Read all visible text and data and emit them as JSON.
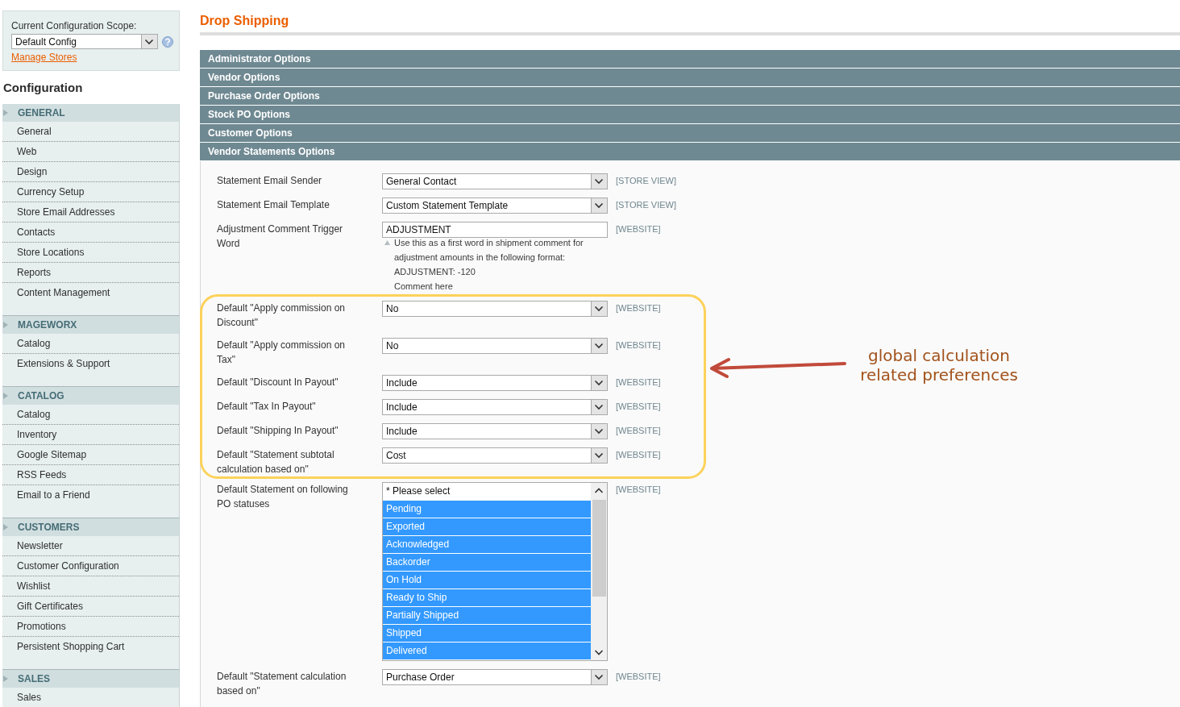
{
  "sidebar": {
    "scope": {
      "label": "Current Configuration Scope:",
      "value": "Default Config",
      "link": "Manage Stores"
    },
    "title": "Configuration",
    "groups": [
      {
        "title": "GENERAL",
        "items": [
          "General",
          "Web",
          "Design",
          "Currency Setup",
          "Store Email Addresses",
          "Contacts",
          "Store Locations",
          "Reports",
          "Content Management"
        ]
      },
      {
        "title": "MAGEWORX",
        "items": [
          "Catalog",
          "Extensions & Support"
        ]
      },
      {
        "title": "CATALOG",
        "items": [
          "Catalog",
          "Inventory",
          "Google Sitemap",
          "RSS Feeds",
          "Email to a Friend"
        ]
      },
      {
        "title": "CUSTOMERS",
        "items": [
          "Newsletter",
          "Customer Configuration",
          "Wishlist",
          "Gift Certificates",
          "Promotions",
          "Persistent Shopping Cart"
        ]
      },
      {
        "title": "SALES",
        "items": [
          "Sales"
        ]
      }
    ]
  },
  "page": {
    "title": "Drop Shipping",
    "sections": [
      {
        "title": "Administrator Options"
      },
      {
        "title": "Vendor Options"
      },
      {
        "title": "Purchase Order Options"
      },
      {
        "title": "Stock PO Options"
      },
      {
        "title": "Customer Options"
      },
      {
        "title": "Vendor Statements Options"
      }
    ]
  },
  "form": {
    "fields": [
      {
        "kind": "select",
        "label": "Statement Email Sender",
        "value": "General Contact",
        "scope": "[STORE VIEW]"
      },
      {
        "kind": "select",
        "label": "Statement Email Template",
        "value": "Custom Statement Template",
        "scope": "[STORE VIEW]"
      },
      {
        "kind": "text",
        "label": "Adjustment Comment Trigger Word",
        "value": "ADJUSTMENT",
        "scope": "[WEBSITE]",
        "note": [
          "Use this as a first word in shipment comment for adjustment amounts in the following format:",
          "ADJUSTMENT: -120",
          "Comment here"
        ]
      }
    ],
    "highlight": {
      "callout": "global calculation related preferences",
      "fields": [
        {
          "kind": "select",
          "label": "Default \"Apply commission on Discount\"",
          "value": "No",
          "scope": "[WEBSITE]"
        },
        {
          "kind": "select",
          "label": "Default \"Apply commission on Tax\"",
          "value": "No",
          "scope": "[WEBSITE]"
        },
        {
          "kind": "select",
          "label": "Default \"Discount In Payout\"",
          "value": "Include",
          "scope": "[WEBSITE]"
        },
        {
          "kind": "select",
          "label": "Default \"Tax In Payout\"",
          "value": "Include",
          "scope": "[WEBSITE]"
        },
        {
          "kind": "select",
          "label": "Default \"Shipping In Payout\"",
          "value": "Include",
          "scope": "[WEBSITE]"
        },
        {
          "kind": "select",
          "label": "Default \"Statement subtotal calculation based on\"",
          "value": "Cost",
          "scope": "[WEBSITE]"
        }
      ]
    },
    "fields_after": [
      {
        "kind": "multiselect",
        "label": "Default Statement on following PO statuses",
        "scope": "[WEBSITE]",
        "options": [
          {
            "label": "* Please select",
            "selected": false
          },
          {
            "label": "Pending",
            "selected": true
          },
          {
            "label": "Exported",
            "selected": true
          },
          {
            "label": "Acknowledged",
            "selected": true
          },
          {
            "label": "Backorder",
            "selected": true
          },
          {
            "label": "On Hold",
            "selected": true
          },
          {
            "label": "Ready to Ship",
            "selected": true
          },
          {
            "label": "Partially Shipped",
            "selected": true
          },
          {
            "label": "Shipped",
            "selected": true
          },
          {
            "label": "Delivered",
            "selected": true
          }
        ]
      },
      {
        "kind": "select",
        "label": "Default \"Statement calculation based on\"",
        "value": "Purchase Order",
        "scope": "[WEBSITE]"
      }
    ]
  }
}
